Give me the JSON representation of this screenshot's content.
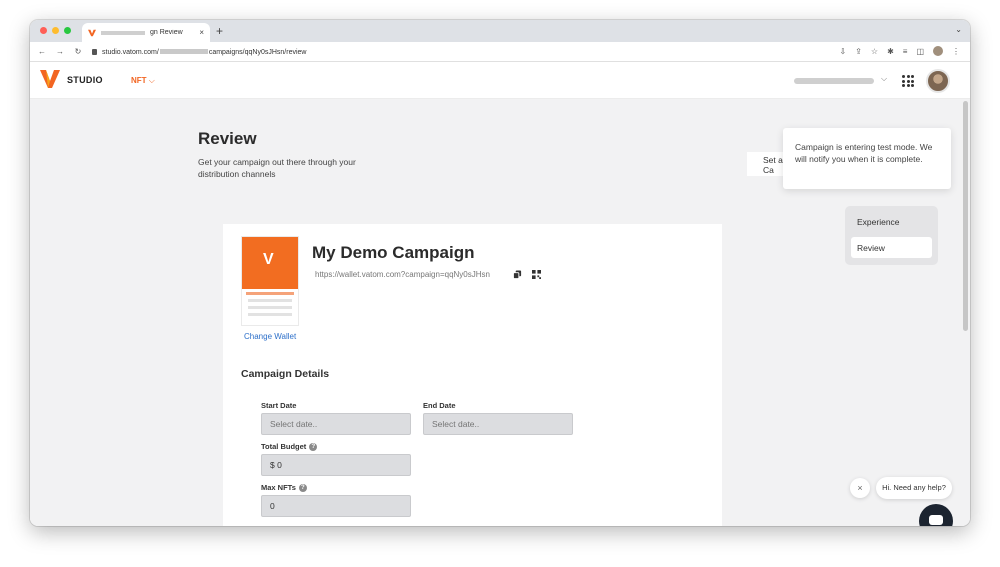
{
  "browser": {
    "tab_title_visible": "gn Review",
    "tab_close": "×",
    "new_tab": "+",
    "url_prefix": "studio.vatom.com/",
    "url_suffix": "campaigns/qqNy0sJHsn/review"
  },
  "header": {
    "brand": "STUDIO",
    "nft_menu": "NFT",
    "nft_chevron": "⌵"
  },
  "page": {
    "title": "Review",
    "subtitle": "Get your campaign out there through your distribution channels"
  },
  "set_label": "Set a Ca",
  "toast": {
    "message": "Campaign is entering test mode. We will notify you when it is complete."
  },
  "steps": [
    {
      "label": "Experience",
      "active": false
    },
    {
      "label": "Review",
      "active": true
    }
  ],
  "campaign": {
    "title": "My Demo Campaign",
    "url": "https://wallet.vatom.com?campaign=qqNy0sJHsn",
    "change_wallet": "Change Wallet",
    "wallet_thumb_logo": "V"
  },
  "details": {
    "heading": "Campaign Details",
    "start_date": {
      "label": "Start Date",
      "placeholder": "Select date.."
    },
    "end_date": {
      "label": "End Date",
      "placeholder": "Select date.."
    },
    "total_budget": {
      "label": "Total Budget",
      "value": "$ 0"
    },
    "max_nfts": {
      "label": "Max NFTs",
      "value": "0"
    },
    "help_glyph": "?"
  },
  "chat": {
    "close": "×",
    "bubble": "Hi. Need any help?"
  },
  "colors": {
    "accent": "#f26522",
    "link": "#2c6fc9",
    "chat": "#1c2430"
  }
}
